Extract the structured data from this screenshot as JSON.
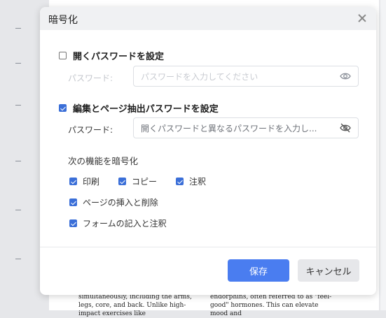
{
  "background": {
    "doc_text_col1": "simultaneously, including the arms, legs, core, and back. Unlike high-impact exercises like",
    "doc_text_col2": "endorphins, often referred to as \"feel-good\" hormones. This can elevate mood and"
  },
  "dialog": {
    "title": "暗号化",
    "open_password": {
      "label": "開くパスワードを設定",
      "checked": false,
      "field_label": "パスワード:",
      "placeholder": "パスワードを入力してください",
      "icon": "eye-icon"
    },
    "edit_password": {
      "label": "編集とページ抽出パスワードを設定",
      "checked": true,
      "field_label": "パスワード:",
      "placeholder": "開くパスワードと異なるパスワードを入力し...",
      "icon": "eye-off-icon"
    },
    "encrypt_heading": "次の機能を暗号化",
    "options": [
      {
        "label": "印刷",
        "checked": true
      },
      {
        "label": "コピー",
        "checked": true
      },
      {
        "label": "注釈",
        "checked": true
      },
      {
        "label": "ページの挿入と削除",
        "checked": true
      },
      {
        "label": "フォームの記入と注釈",
        "checked": true
      }
    ],
    "save_label": "保存",
    "cancel_label": "キャンセル",
    "colors": {
      "accent": "#4a7df0",
      "checkbox": "#3b6fd8"
    }
  }
}
